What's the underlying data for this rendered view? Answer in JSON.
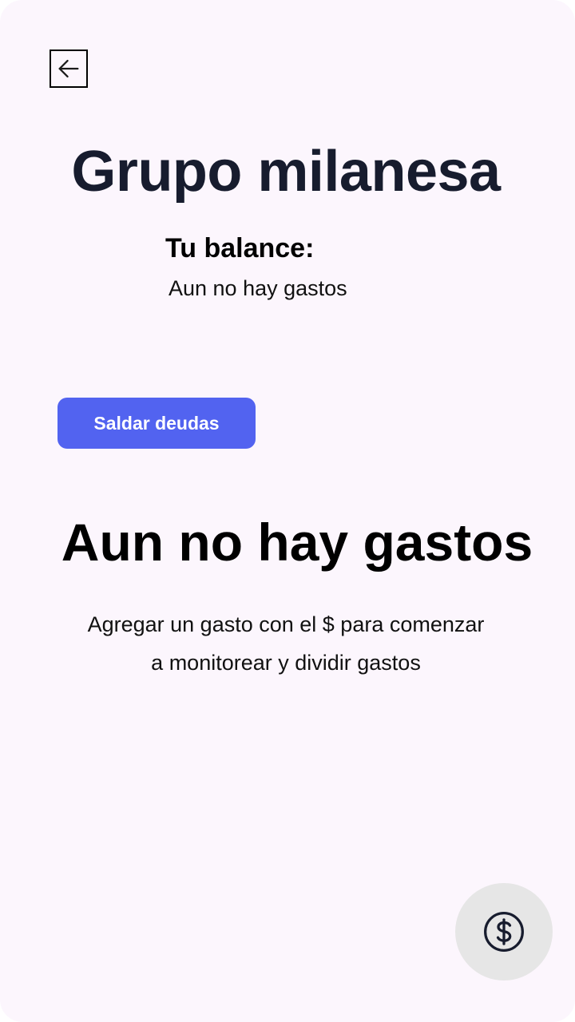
{
  "header": {
    "back_icon": "arrow-left-icon",
    "title": "Grupo milanesa"
  },
  "balance": {
    "label": "Tu balance:",
    "value": "Aun no hay gastos"
  },
  "actions": {
    "settle_label": "Saldar deudas"
  },
  "empty_state": {
    "title": "Aun no hay gastos",
    "description_line1": "Agregar un gasto con el $ para comenzar",
    "description_line2": "a monitorear y dividir gastos"
  },
  "fab": {
    "icon": "dollar-circle-icon"
  },
  "colors": {
    "background": "#fcf6fd",
    "accent": "#5263f0",
    "title": "#171c2e",
    "fab_background": "#e6e6e6"
  }
}
